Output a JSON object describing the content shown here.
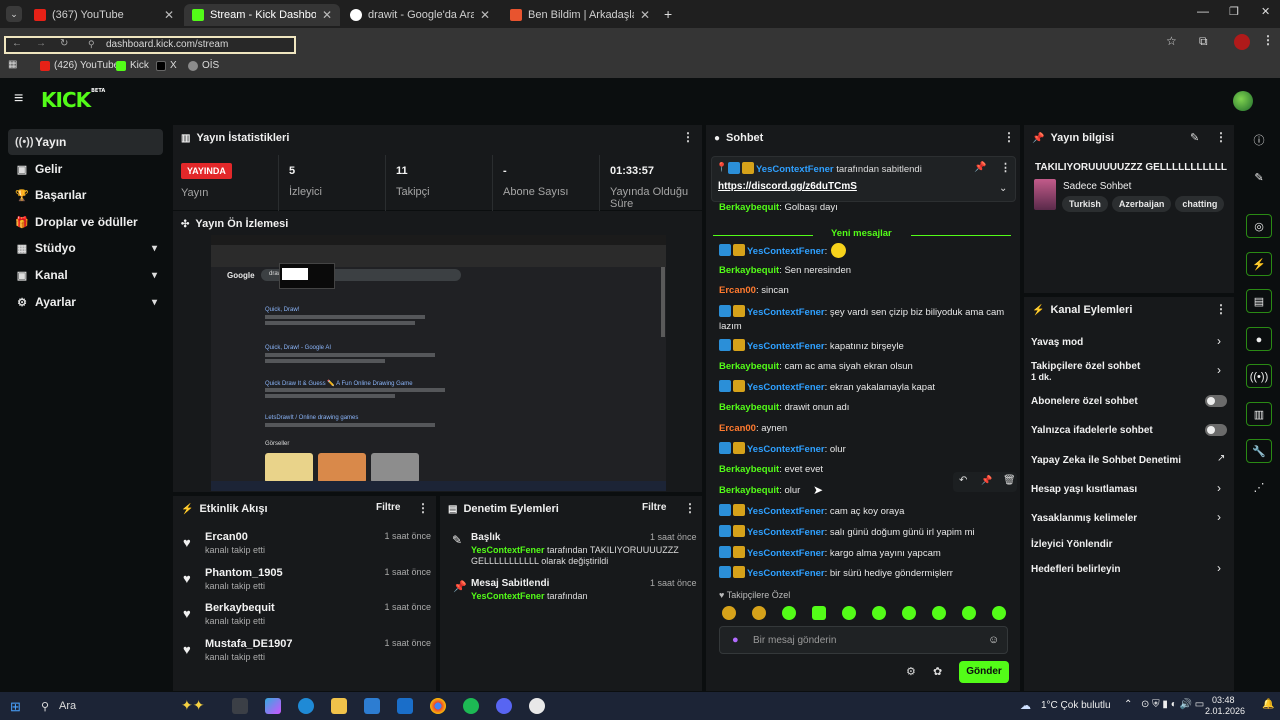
{
  "browser": {
    "tabs": [
      {
        "label": "(367) YouTube",
        "color": "#e62117"
      },
      {
        "label": "Stream - Kick Dashboard",
        "color": "#53fc18"
      },
      {
        "label": "drawit - Google'da Ara",
        "color": "#ffffff"
      },
      {
        "label": "Ben Bildim | Arkadaşlarınla Onli...",
        "color": "#e8542f"
      }
    ],
    "url": "dashboard.kick.com/stream",
    "bookmarks": [
      "(426) YouTube",
      "Kick",
      "X",
      "OİS"
    ]
  },
  "kick": {
    "logo": "KICK",
    "logo_sup": "BETA"
  },
  "sidebar": {
    "items": [
      {
        "label": "Yayın",
        "icon": "((•))"
      },
      {
        "label": "Gelir",
        "icon": "▣"
      },
      {
        "label": "Başarılar",
        "icon": "🏆"
      },
      {
        "label": "Droplar ve ödüller",
        "icon": "🎁"
      },
      {
        "label": "Stüdyo",
        "icon": "▦"
      },
      {
        "label": "Kanal",
        "icon": "▣"
      },
      {
        "label": "Ayarlar",
        "icon": "⚙"
      }
    ]
  },
  "stats": {
    "title": "Yayın İstatistikleri",
    "live_badge": "YAYINDA",
    "live_label": "Yayın",
    "cells": [
      {
        "value": "5",
        "label": "İzleyici"
      },
      {
        "value": "11",
        "label": "Takipçi"
      },
      {
        "value": "-",
        "label": "Abone Sayısı"
      },
      {
        "value": "01:33:57",
        "label": "Yayında Olduğu Süre"
      }
    ]
  },
  "preview": {
    "title": "Yayın Ön İzlemesi",
    "google_logo": "Google",
    "search_text": "drawit",
    "result_titles": [
      "Quick, Draw!",
      "Quick, Draw! - Google AI",
      "Quick Draw It & Guess ✏️ A Fun Online Drawing Game",
      "LetsDrawIt / Online drawing games"
    ],
    "images_label": "Görseller"
  },
  "activity": {
    "title": "Etkinlik Akışı",
    "filter": "Filtre",
    "items": [
      {
        "name": "Ercan00",
        "sub": "kanalı takip etti",
        "time": "1 saat önce"
      },
      {
        "name": "Phantom_1905",
        "sub": "kanalı takip etti",
        "time": "1 saat önce"
      },
      {
        "name": "Berkaybequit",
        "sub": "kanalı takip etti",
        "time": "1 saat önce"
      },
      {
        "name": "Mustafa_DE1907",
        "sub": "kanalı takip etti",
        "time": "1 saat önce"
      }
    ]
  },
  "moderation": {
    "title": "Denetim Eylemleri",
    "filter": "Filtre",
    "items": [
      {
        "title": "Başlık",
        "time": "1 saat önce",
        "actor": "YesContextFener",
        "text": " tarafından TAKILIYORUUUUZZZ GELLLLLLLLLLL olarak değiştirildi"
      },
      {
        "title": "Mesaj Sabitlendi",
        "time": "1 saat önce",
        "actor": "YesContextFener",
        "text": " tarafından"
      }
    ]
  },
  "chat": {
    "title": "Sohbet",
    "pinned": {
      "user": "YesContextFener",
      "by": " tarafından sabitlendi",
      "link": "https://discord.gg/z6duTCmS"
    },
    "new_messages": "Yeni mesajlar",
    "messages": [
      {
        "user": "Berkaybequit",
        "color": "#53fc18",
        "badges": 0,
        "text": ": Golbaşı dayı"
      },
      {
        "user": "YesContextFener",
        "color": "#2fa0ff",
        "badges": 2,
        "text": ":"
      },
      {
        "user": "Berkaybequit",
        "color": "#53fc18",
        "badges": 0,
        "text": ": Sen neresinden"
      },
      {
        "user": "Ercan00",
        "color": "#ff7a2f",
        "badges": 0,
        "text": ": sincan"
      },
      {
        "user": "YesContextFener",
        "color": "#2fa0ff",
        "badges": 2,
        "text": ": şey vardı sen çizip biz biliyoduk ama cam lazım"
      },
      {
        "user": "YesContextFener",
        "color": "#2fa0ff",
        "badges": 2,
        "text": ": kapatınız birşeyle"
      },
      {
        "user": "Berkaybequit",
        "color": "#53fc18",
        "badges": 0,
        "text": ": cam ac ama siyah ekran olsun"
      },
      {
        "user": "YesContextFener",
        "color": "#2fa0ff",
        "badges": 2,
        "text": ": ekran yakalamayla kapat"
      },
      {
        "user": "Berkaybequit",
        "color": "#53fc18",
        "badges": 0,
        "text": ": drawit onun adı"
      },
      {
        "user": "Ercan00",
        "color": "#ff7a2f",
        "badges": 0,
        "text": ": aynen"
      },
      {
        "user": "YesContextFener",
        "color": "#2fa0ff",
        "badges": 2,
        "text": ": olur"
      },
      {
        "user": "Berkaybequit",
        "color": "#53fc18",
        "badges": 0,
        "text": ": evet evet"
      },
      {
        "user": "Berkaybequit",
        "color": "#53fc18",
        "badges": 0,
        "text": ": olur"
      },
      {
        "user": "YesContextFener",
        "color": "#2fa0ff",
        "badges": 2,
        "text": ": cam aç koy oraya"
      },
      {
        "user": "YesContextFener",
        "color": "#2fa0ff",
        "badges": 2,
        "text": ": salı günü doğum günü irl yapim mi"
      },
      {
        "user": "YesContextFener",
        "color": "#2fa0ff",
        "badges": 2,
        "text": ": kargo alma yayını yapcam"
      },
      {
        "user": "YesContextFener",
        "color": "#2fa0ff",
        "badges": 2,
        "text": ": bir sürü hediye göndermişlerr"
      }
    ],
    "followers_only": "Takipçilere Özel",
    "input_placeholder": "Bir mesaj gönderin",
    "send": "Gönder"
  },
  "stream_info": {
    "title": "Yayın bilgisi",
    "stream_title": "TAKILIYORUUUUUZZZ GELLLLLLLLLLL",
    "category": "Sadece Sohbet",
    "tags": [
      "Turkish",
      "Azerbaijan",
      "chatting"
    ]
  },
  "channel_actions": {
    "title": "Kanal Eylemleri",
    "items": [
      {
        "label": "Yavaş mod",
        "control": "chevron"
      },
      {
        "label": "Takipçilere özel sohbet",
        "sub": "1 dk.",
        "control": "chevron"
      },
      {
        "label": "Abonelere özel sohbet",
        "control": "toggle"
      },
      {
        "label": "Yalnızca ifadelerle sohbet",
        "control": "toggle"
      },
      {
        "label": "Yapay Zeka ile Sohbet Denetimi",
        "control": "external"
      },
      {
        "label": "Hesap yaşı kısıtlaması",
        "control": "chevron"
      },
      {
        "label": "Yasaklanmış kelimeler",
        "control": "chevron"
      },
      {
        "label": "İzleyici Yönlendir",
        "control": "none"
      },
      {
        "label": "Hedefleri belirleyin",
        "control": "chevron"
      }
    ]
  },
  "taskbar": {
    "search": "Ara",
    "weather": "1°C  Çok bulutlu",
    "time": "03:48",
    "date": "2.01.2026"
  }
}
